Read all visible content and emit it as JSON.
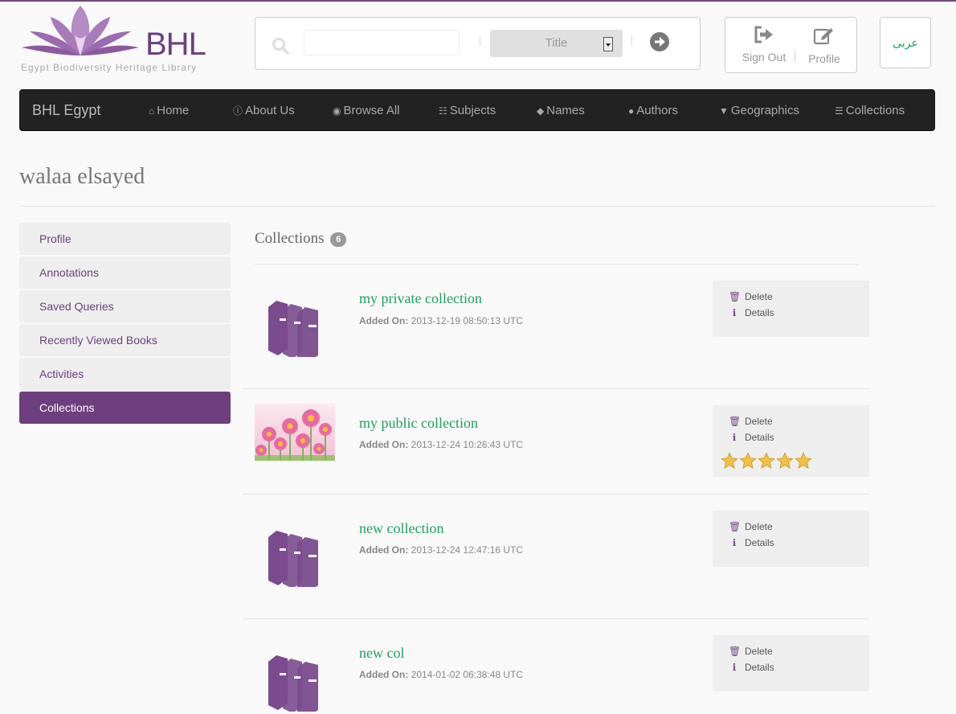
{
  "header": {
    "logo_text": "BHL",
    "logo_subtitle": "Egypt Biodiversity Heritage Library",
    "search": {
      "placeholder": "",
      "scope_selected": "Title"
    },
    "user": {
      "signout_label": "Sign Out",
      "profile_label": "Profile"
    },
    "lang_label": "عربى"
  },
  "navbar": {
    "brand": "BHL Egypt",
    "items": [
      {
        "label": "Home",
        "icon": "home-icon"
      },
      {
        "label": "About Us",
        "icon": "info-icon"
      },
      {
        "label": "Browse All",
        "icon": "globe-icon"
      },
      {
        "label": "Subjects",
        "icon": "sitemap-icon"
      },
      {
        "label": "Names",
        "icon": "tags-icon"
      },
      {
        "label": "Authors",
        "icon": "user-icon"
      },
      {
        "label": "Geographics",
        "icon": "map-marker-icon"
      },
      {
        "label": "Collections",
        "icon": "collections-icon"
      }
    ]
  },
  "page": {
    "title": "walaa elsayed"
  },
  "sidebar": {
    "items": [
      {
        "label": "Profile"
      },
      {
        "label": "Annotations"
      },
      {
        "label": "Saved Queries"
      },
      {
        "label": "Recently Viewed Books"
      },
      {
        "label": "Activities"
      },
      {
        "label": "Collections",
        "active": true
      }
    ]
  },
  "collections": {
    "heading": "Collections",
    "count": "6",
    "added_label": "Added On:",
    "delete_label": "Delete",
    "details_label": "Details",
    "items": [
      {
        "name": "my private collection",
        "added_on": "2013-12-19 08:50:13 UTC",
        "thumbnail": "books-icon"
      },
      {
        "name": "my public collection",
        "added_on": "2013-12-24 10:26:43 UTC",
        "thumbnail": "flowers-photo",
        "rating": 5
      },
      {
        "name": "new collection",
        "added_on": "2013-12-24 12:47:16 UTC",
        "thumbnail": "books-icon"
      },
      {
        "name": "new col",
        "added_on": "2014-01-02 06:38:48 UTC",
        "thumbnail": "books-icon"
      }
    ]
  },
  "colors": {
    "brand_purple": "#6d3f7f",
    "link_green": "#1ea062",
    "navbar_bg": "#222222",
    "star": "#f3c141"
  }
}
